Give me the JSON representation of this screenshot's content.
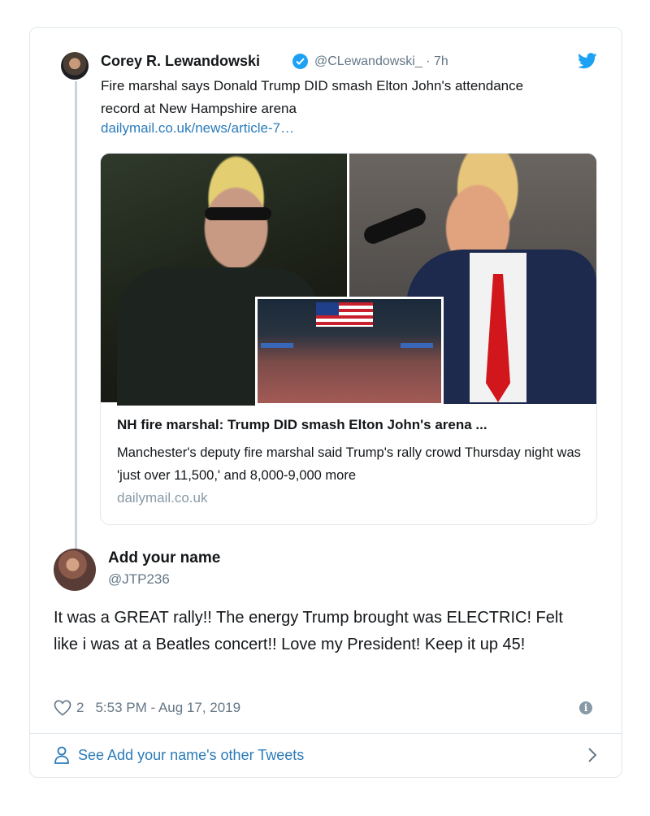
{
  "quoted_tweet": {
    "author_name": "Corey R. Lewandowski",
    "handle": "@CLewandowski_",
    "time": " · 7h",
    "text": "Fire marshal says Donald Trump DID smash Elton John's attendance record at New Hampshire arena",
    "link_text": "dailymail.co.uk/news/article-7…",
    "verified": true
  },
  "link_card": {
    "title": "NH fire marshal: Trump DID smash Elton John's arena ...",
    "description": "Manchester's deputy fire marshal said Trump's rally crowd Thursday night was 'just over 11,500,' and 8,000-9,000 more",
    "domain": "dailymail.co.uk"
  },
  "reply": {
    "author_name": "Add your name",
    "handle": "@JTP236",
    "text": "It was a GREAT rally!! The energy Trump brought was ELECTRIC! Felt like i was at a Beatles concert!! Love my President! Keep it up 45!",
    "like_count": "2",
    "timestamp": "5:53 PM - Aug 17, 2019"
  },
  "footer": {
    "see_more_label": "See Add your name's other Tweets"
  },
  "colors": {
    "accent": "#2b7bb9",
    "twitter_blue": "#1da1f2",
    "muted": "#657786",
    "border": "#e1e8ed"
  },
  "icons": [
    "verified-badge-icon",
    "twitter-bird-icon",
    "heart-icon",
    "info-icon",
    "person-icon",
    "chevron-right-icon"
  ]
}
